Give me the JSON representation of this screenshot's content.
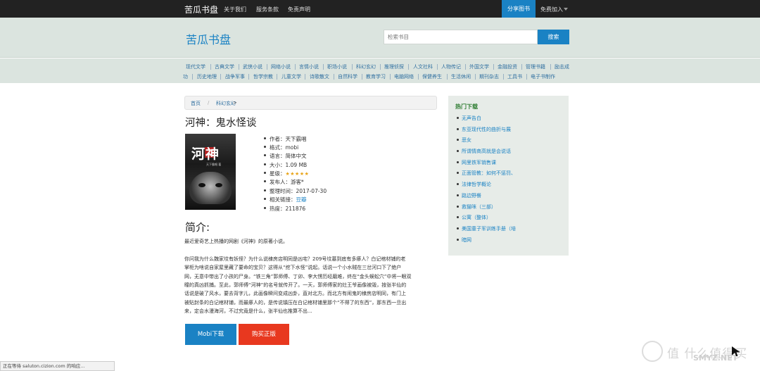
{
  "topnav": {
    "brand": "苦瓜书盘",
    "links": [
      "关于我们",
      "服务条款",
      "免责声明"
    ],
    "share": "分享图书",
    "join": "免费加入"
  },
  "header": {
    "logo": "苦瓜书盘",
    "search_placeholder": "检索书目",
    "search_button": "搜索"
  },
  "categories_row1": [
    "现代文学",
    "古典文学",
    "武侠小说",
    "网络小说",
    "言情小说",
    "职场小说",
    "科幻玄幻",
    "推理侦探",
    "人文社科",
    "人物传记",
    "外国文学",
    "金融投资",
    "管理书籍",
    "励志成"
  ],
  "categories_row2": [
    "功",
    "历史地理",
    "战争军事",
    "哲学宗教",
    "儿童文学",
    "诗歌散文",
    "自然科学",
    "教育学习",
    "电脑网络",
    "保健养生",
    "生活休闲",
    "期刊杂志",
    "工具书",
    "电子书制作"
  ],
  "breadcrumb": {
    "home": "首页",
    "sep": "/",
    "current": "科幻玄幻",
    "arrow": ">"
  },
  "book": {
    "title": "河神：鬼水怪谈",
    "cover_title": "河神",
    "cover_author": "天下霸唱 著",
    "meta": {
      "author": "作者：天下霸唱",
      "format": "格式：mobi",
      "language": "语言：简体中文",
      "size": "大小：1.09 MB",
      "rating_label": "星级：",
      "rating_stars": "★★★★★",
      "publisher": "发布人：游客*",
      "date": "整理时间：2017-07-30",
      "related_label": "相关链接：",
      "related_link": "豆瓣",
      "views": "热度：211876"
    }
  },
  "intro": {
    "heading": "简介:",
    "lead": "最近爱奇艺上热播的网剧《河神》的原著小说。",
    "lines": [
      "你问我为什么魏家坟有妖怪？为什么说棣房店明同是凶宅？209号坟墓到底有多瘆人？白记棺材铺的老",
      "掌柜为啥说自家屋里藏了要命的宝贝？这得从“挖下水怪”说起。话说一个小水贼在三岔河口下了绝户",
      "网，无意中带出了小孩的尸身。“铁三角”郭师傅、丁卯、李大愣历经磨难，终在“金头蜈蚣穴”中将一眼双",
      "瞳的真凶抓捕。至此，郭师傅“河神”的名号就传开了。一天，郭师傅家的灶王爷画像被毁，按张半仙的",
      "话说是破了风水，要去背字儿，此画像瞬间变成凶卦，直对北方。而北方有闹鬼的棣房店明同，有门上",
      "被贴封条的白记棺材铺，而最瘆人的，是传说镇压在白记棺材铺里那个“不得了的东西”，那东西一旦出",
      "来，定会水漫海河，不过究竟是什么，张半仙也推算不出..."
    ]
  },
  "buttons": {
    "mobi": "Mobi下载",
    "buy": "购买正版"
  },
  "sidebar": {
    "title": "热门下载",
    "items": [
      "无声告白",
      "东亚现代性的曲折与展",
      "恶女",
      "所谓情商高就是会说话",
      "网里铁军销售课",
      "正面管教：如何不惩罚、",
      "法律哲学概论",
      "路边野餐",
      "救猫咪（三部）",
      "公寓（整体）",
      "美国童子军训练手册（培",
      "暗网"
    ]
  },
  "status": {
    "text": "正在等待 saluton.cizion.com 的响应..."
  },
  "watermark": {
    "main": "值 什么值得买",
    "sub": "SMYZ.NET"
  },
  "colors": {
    "accent": "#1a82c4",
    "buy": "#e8381f",
    "header_bg": "#dbe4df",
    "topbar": "#222222"
  }
}
